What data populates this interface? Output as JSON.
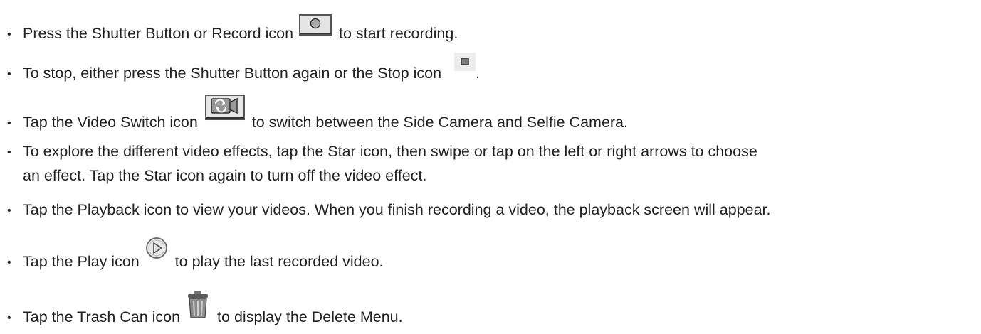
{
  "bullet_char": "•",
  "items": [
    {
      "before": "Press the Shutter Button or Record icon ",
      "icon": "record-icon",
      "after": " to start recording."
    },
    {
      "before": "To stop, either press the Shutter Button again or the Stop icon ",
      "icon": "stop-icon",
      "after": "."
    },
    {
      "before": "Tap the Video Switch icon ",
      "icon": "video-switch-icon",
      "after": " to switch between the Side Camera and Selfie Camera."
    },
    {
      "line1": "To explore the different video effects, tap the Star icon, then swipe or tap on the left or right arrows to choose",
      "line2": "an effect. Tap the Star icon again to turn off the video effect."
    },
    {
      "text": "Tap the Playback icon to view your videos. When you finish recording a video, the playback screen will appear."
    },
    {
      "before": "Tap the Play icon ",
      "icon": "play-icon",
      "after": " to play the last recorded video."
    },
    {
      "before": "Tap the Trash Can icon ",
      "icon": "trash-can-icon",
      "after": " to display the Delete Menu."
    }
  ]
}
